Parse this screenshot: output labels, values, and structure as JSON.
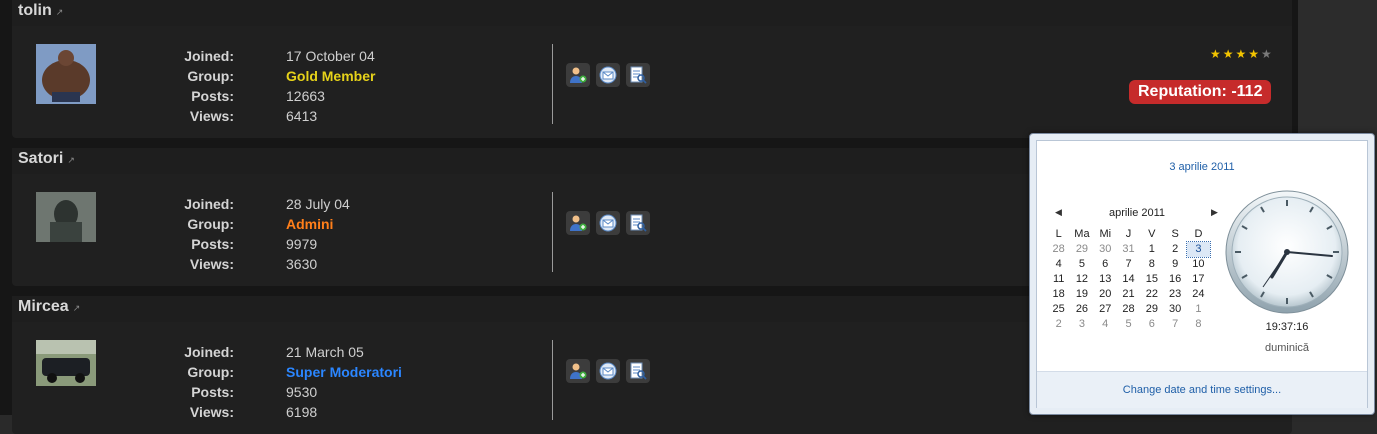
{
  "labels": {
    "joined": "Joined:",
    "group": "Group:",
    "posts": "Posts:",
    "views": "Views:"
  },
  "members": [
    {
      "name": "tolin",
      "joined": "17 October 04",
      "group": "Gold Member",
      "group_color": "#e6d21a",
      "posts": "12663",
      "views": "6413",
      "stars_filled": 4,
      "stars_total": 5,
      "reputation": "Reputation: -112"
    },
    {
      "name": "Satori",
      "joined": "28 July 04",
      "group": "Admini",
      "group_color": "#ff7f1a",
      "posts": "9979",
      "views": "3630"
    },
    {
      "name": "Mircea",
      "joined": "21 March 05",
      "group": "Super Moderatori",
      "group_color": "#2b86ff",
      "posts": "9530",
      "views": "6198"
    }
  ],
  "action_icons": [
    "add-friend-icon",
    "send-message-icon",
    "find-posts-icon"
  ],
  "calendar_popup": {
    "long_date": "3 aprilie 2011",
    "month_label": "aprilie 2011",
    "weekdays": [
      "L",
      "Ma",
      "Mi",
      "J",
      "V",
      "S",
      "D"
    ],
    "days": [
      [
        "28",
        "29",
        "30",
        "31",
        "1",
        "2",
        "3"
      ],
      [
        "4",
        "5",
        "6",
        "7",
        "8",
        "9",
        "10"
      ],
      [
        "11",
        "12",
        "13",
        "14",
        "15",
        "16",
        "17"
      ],
      [
        "18",
        "19",
        "20",
        "21",
        "22",
        "23",
        "24"
      ],
      [
        "25",
        "26",
        "27",
        "28",
        "29",
        "30",
        "1"
      ],
      [
        "2",
        "3",
        "4",
        "5",
        "6",
        "7",
        "8"
      ]
    ],
    "today": "3",
    "time": "19:37:16",
    "day_name": "duminică",
    "settings_link": "Change date and time settings..."
  }
}
